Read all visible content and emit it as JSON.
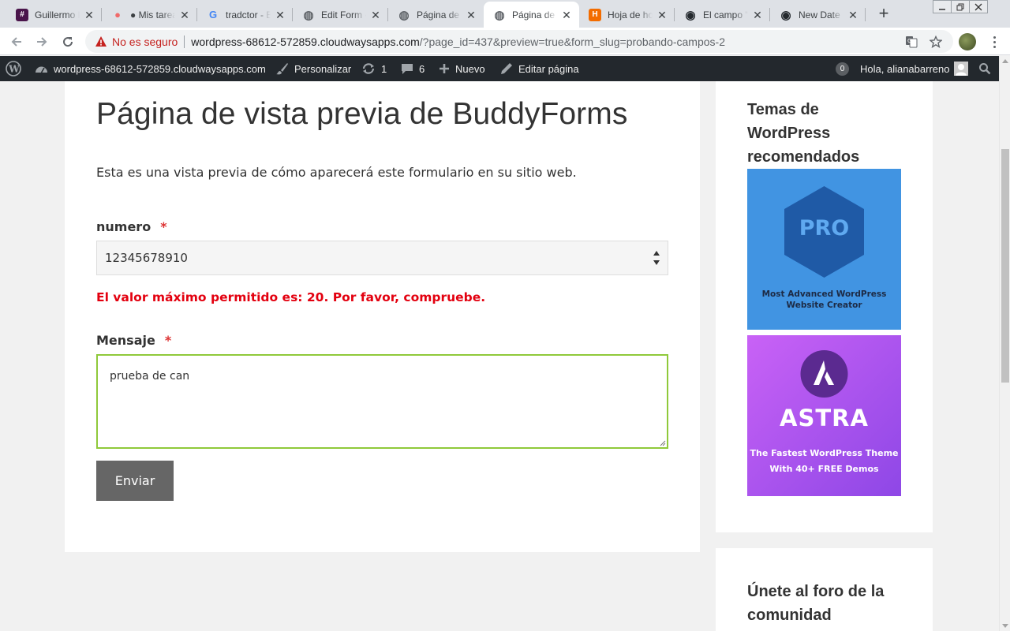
{
  "browser": {
    "tabs": [
      {
        "title": "Guillermo Fi",
        "favicon": "slack-icon",
        "color": "#4a154b"
      },
      {
        "title": "● Mis tareas",
        "favicon": "asana-icon",
        "color": "#f06a6a"
      },
      {
        "title": "tradctor - B",
        "favicon": "google-icon",
        "color": "#4285f4"
      },
      {
        "title": "Edit Form «",
        "favicon": "globe-icon",
        "color": "#5f6368"
      },
      {
        "title": "Página de v",
        "favicon": "globe-icon",
        "color": "#5f6368"
      },
      {
        "title": "Página de v",
        "favicon": "globe-icon",
        "color": "#5f6368"
      },
      {
        "title": "Hoja de hor",
        "favicon": "harvest-icon",
        "color": "#f36c00"
      },
      {
        "title": "El campo \"r",
        "favicon": "github-icon",
        "color": "#24292e"
      },
      {
        "title": "New Date F",
        "favicon": "github-icon",
        "color": "#24292e"
      }
    ],
    "active_tab": 5,
    "security_label": "No es seguro",
    "url_host": "wordpress-68612-572859.cloudwaysapps.com",
    "url_path": "/?page_id=437&preview=true&form_slug=probando-campos-2"
  },
  "adminbar": {
    "site": "wordpress-68612-572859.cloudwaysapps.com",
    "customize": "Personalizar",
    "updates_count": "1",
    "comments_count": "6",
    "new": "Nuevo",
    "edit_page": "Editar página",
    "notif_count": "0",
    "greeting": "Hola, alianabarreno"
  },
  "page": {
    "title": "Página de vista previa de BuddyForms",
    "intro": "Esta es una vista previa de cómo aparecerá este formulario en su sitio web.",
    "number_label": "numero",
    "required_mark": "*",
    "number_value": "12345678910",
    "error_message": "El valor máximo permitido es: 20. Por favor, compruebe.",
    "message_label": "Mensaje",
    "message_value": "prueba de can",
    "submit_label": "Enviar"
  },
  "sidebar": {
    "widget1_title": "Temas de WordPress recomendados",
    "pro_badge": "PRO",
    "pro_caption_1": "Most Advanced WordPress",
    "pro_caption_2": "Website Creator",
    "astra_name": "ASTRA",
    "astra_caption_1": "The Fastest WordPress Theme",
    "astra_caption_2": "With 40+ FREE Demos",
    "widget2_title": "Únete al foro de la comunidad"
  }
}
